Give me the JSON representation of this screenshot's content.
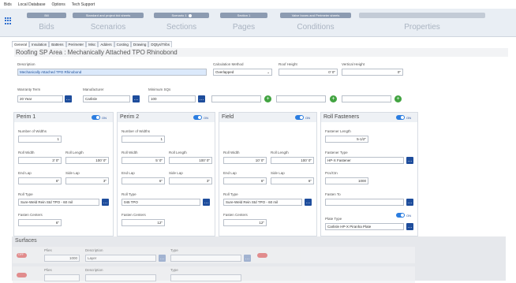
{
  "menu": {
    "items": [
      "Bids",
      "Local Database",
      "Options",
      "Tech Support"
    ]
  },
  "ribbon": {
    "tabs": [
      {
        "pill": "Bill",
        "big": "Bids",
        "color": "#8c9bb1"
      },
      {
        "pill": "Standard and project bid sheets",
        "big": "Scenarios",
        "color": "#8c9bb1"
      },
      {
        "pill": "Scenario 1",
        "big": "Sections",
        "color": "#8c9bb1"
      },
      {
        "pill": "Section 1",
        "big": "Pages",
        "color": "#8c9bb1"
      },
      {
        "pill": "Valve boxes and Perimeter sheets",
        "big": "Conditions",
        "color": "#8c9bb1"
      },
      {
        "pill": "",
        "big": "Properties",
        "color": "#c3cbd6"
      }
    ]
  },
  "tabs": [
    "General",
    "Insulation",
    "Battens",
    "Perimeter",
    "Misc",
    "Adders",
    "Costing",
    "Drawing",
    "DQtys/Tribs"
  ],
  "title": "Roofing SP Area : Mechanically Attached TPO Rhinobond",
  "fields": {
    "description_label": "Description",
    "description": "Mechanically Attached TPO Rhinobond",
    "calc_label": "Calculation Method",
    "calc": "Overlapped",
    "roof_height_label": "Roof Height",
    "roof_height": "0' 0\"",
    "vertical_height_label": "Vertical Height",
    "vertical_height": "0\"",
    "warranty_label": "Warranty Term",
    "warranty": "20 Year",
    "manufacturer_label": "Manufacturer",
    "manufacturer": "Carlisle",
    "min_sq_label": "Minimum SQs",
    "min_sq": "100"
  },
  "panels": {
    "perim1": {
      "title": "Perim 1",
      "toggle": "ON",
      "num_widths_label": "Number of Widths",
      "num_widths": "1",
      "roll_width_label": "Roll Width",
      "roll_width": "3' 0\"",
      "roll_length_label": "Roll Length",
      "roll_length": "100' 0\"",
      "end_lap_label": "End Lap",
      "end_lap": "6\"",
      "side_lap_label": "Side Lap",
      "side_lap": "3\"",
      "roll_type_label": "Roll Type",
      "roll_type": "Sure-Weld Rein Std TPO - 60 mil",
      "fasten_label": "Fasten Centers",
      "fasten": "6\""
    },
    "perim2": {
      "title": "Perim 2",
      "toggle": "ON",
      "num_widths_label": "Number of Widths",
      "num_widths": "1",
      "roll_width_label": "Roll Width",
      "roll_width": "5' 0\"",
      "roll_length_label": "Roll Length",
      "roll_length": "100' 0\"",
      "end_lap_label": "End Lap",
      "end_lap": "6\"",
      "side_lap_label": "Side Lap",
      "side_lap": "3\"",
      "roll_type_label": "Roll Type",
      "roll_type": "045 TPO",
      "fasten_label": "Fasten Centers",
      "fasten": "12\""
    },
    "field": {
      "title": "Field",
      "toggle": "ON",
      "roll_width_label": "Roll Width",
      "roll_width": "10' 0\"",
      "roll_length_label": "Roll Length",
      "roll_length": "100' 0\"",
      "end_lap_label": "End Lap",
      "end_lap": "6\"",
      "side_lap_label": "Side Lap",
      "side_lap": "6\"",
      "roll_type_label": "Roll Type",
      "roll_type": "Sure-Weld Rein Std TPO - 60 mil",
      "fasten_label": "Fasten Centers",
      "fasten": "12\""
    },
    "fasteners": {
      "title": "Roll Fasteners",
      "toggle": "ON",
      "length_label": "Fastener Length",
      "length": "5-1/2\"",
      "type_label": "Fastener Type",
      "type": "HP-X Fastener",
      "pcs_label": "Pcs/Ctn",
      "pcs": "1000",
      "fasten_to_label": "Fasten To",
      "fasten_to": "",
      "plate_label": "Plate Type",
      "plate_toggle": "ON",
      "plate": "Carlisle HP-X Piranha Plate"
    }
  },
  "surfaces": {
    "title": "Surfaces",
    "row1": {
      "toggle": "OFF",
      "plies_label": "Plies",
      "plies": "1000",
      "desc_label": "Description",
      "desc": "Layer",
      "type_label": "Type"
    },
    "row2": {
      "plies_label": "Plies",
      "desc_label": "Description",
      "type_label": "Type"
    }
  }
}
